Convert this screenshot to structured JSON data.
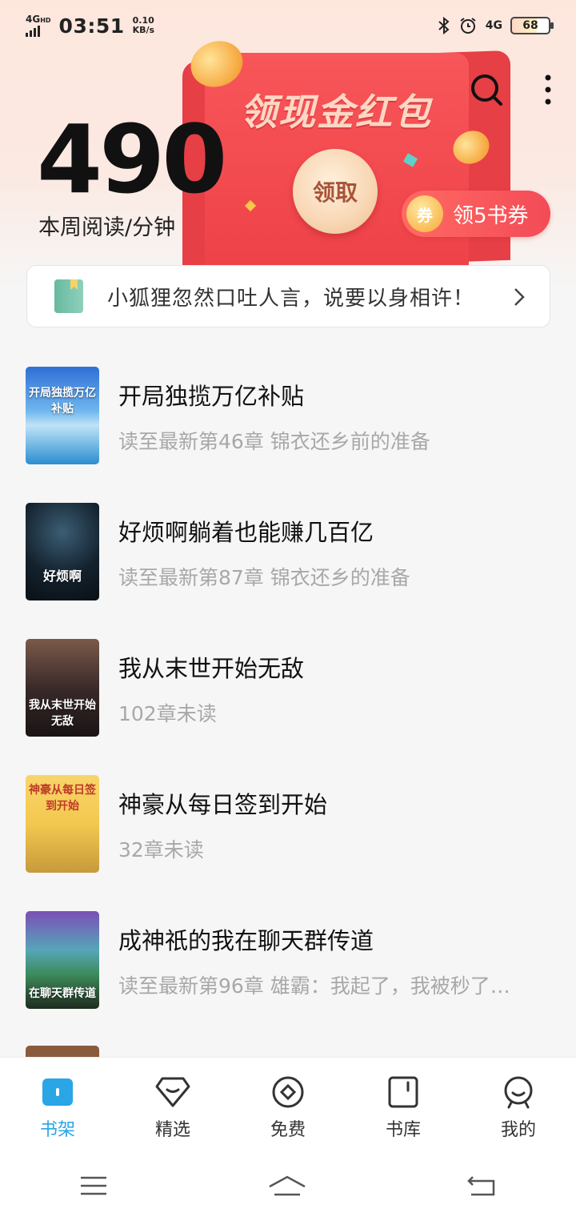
{
  "status_bar": {
    "network_top": "4G",
    "network_hd": "HD",
    "time": "03:51",
    "speed_value": "0.10",
    "speed_unit": "KB/s",
    "network_right": "4G",
    "battery": "68"
  },
  "stats": {
    "minutes": "490",
    "label": "本周阅读/分钟"
  },
  "promo": {
    "title": "领现金红包",
    "claim_button": "领取",
    "voucher_icon": "券",
    "voucher_label": "领5书券"
  },
  "notice": {
    "text": "小狐狸忽然口吐人言，说要以身相许！"
  },
  "books": [
    {
      "title": "开局独揽万亿补贴",
      "subtitle": "读至最新第46章 锦衣还乡前的准备",
      "cover_text": "开局独揽万亿补贴"
    },
    {
      "title": "好烦啊躺着也能赚几百亿",
      "subtitle": "读至最新第87章 锦衣还乡的准备",
      "cover_text": "好烦啊"
    },
    {
      "title": "我从末世开始无敌",
      "subtitle": "102章未读",
      "cover_text": "我从末世开始无敌"
    },
    {
      "title": "神豪从每日签到开始",
      "subtitle": "32章未读",
      "cover_text": "神豪从每日签到开始"
    },
    {
      "title": "成神祇的我在聊天群传道",
      "subtitle": "读至最新第96章 雄霸：我起了，我被秒了…",
      "cover_text": "在聊天群传道"
    }
  ],
  "nav": {
    "items": [
      {
        "label": "书架",
        "icon": "bookshelf-icon"
      },
      {
        "label": "精选",
        "icon": "diamond-icon"
      },
      {
        "label": "免费",
        "icon": "free-icon"
      },
      {
        "label": "书库",
        "icon": "library-icon"
      },
      {
        "label": "我的",
        "icon": "profile-icon"
      }
    ],
    "active_color": "#2aa5e6"
  }
}
